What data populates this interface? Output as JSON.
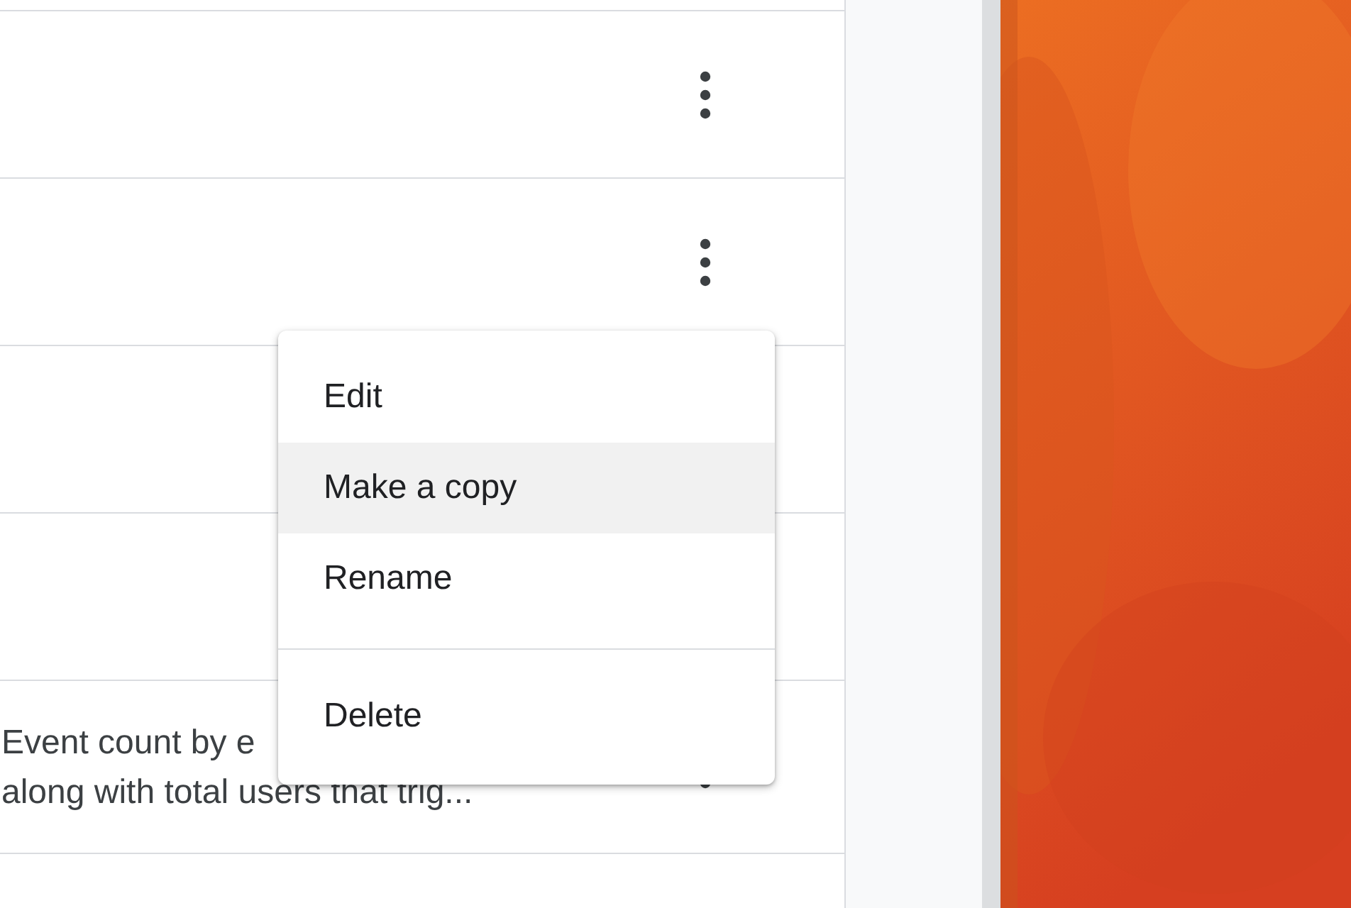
{
  "rows": [
    {
      "kind": "plain",
      "more_button": true
    },
    {
      "kind": "plain",
      "more_button": true
    },
    {
      "kind": "plain",
      "more_button": false
    },
    {
      "kind": "plain",
      "more_button": false
    },
    {
      "kind": "text",
      "more_button": true,
      "description": [
        "Event count by e",
        "along with total users that trig..."
      ]
    }
  ],
  "menu": {
    "items": [
      {
        "label": "Edit",
        "selected": false
      },
      {
        "label": "Make a copy",
        "selected": true
      },
      {
        "label": "Rename",
        "selected": false
      },
      {
        "label": "Delete",
        "selected": false,
        "divider_before": true
      }
    ]
  }
}
